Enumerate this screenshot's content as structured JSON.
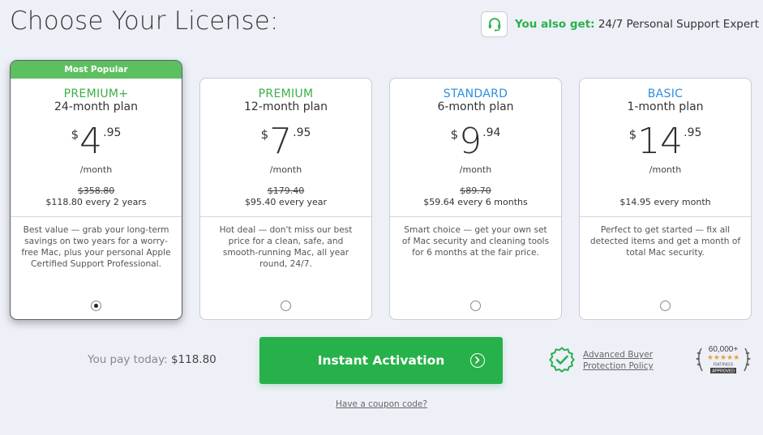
{
  "page": {
    "title": "Choose Your License:",
    "support_prefix": "You also get:",
    "support_text": "24/7 Personal Support Expert"
  },
  "plans": [
    {
      "ribbon": "Most Popular",
      "tier": "PREMIUM+",
      "term": "24-month plan",
      "currency": "$",
      "price_int": "4",
      "price_dec": ".95",
      "per_month": "/month",
      "old_price": "$358.80",
      "billed": "$118.80 every 2 years",
      "description": "Best value — grab your long-term savings on two years for a worry-free Mac, plus your personal Apple Certified Support Professional.",
      "selected": true
    },
    {
      "tier": "PREMIUM",
      "term": "12-month plan",
      "currency": "$",
      "price_int": "7",
      "price_dec": ".95",
      "per_month": "/month",
      "old_price": "$179.40",
      "billed": "$95.40 every year",
      "description": "Hot deal — don't miss our best price for a clean, safe, and smooth-running Mac, all year round, 24/7.",
      "selected": false
    },
    {
      "tier": "STANDARD",
      "term": "6-month plan",
      "currency": "$",
      "price_int": "9",
      "price_dec": ".94",
      "per_month": "/month",
      "old_price": "$89.70",
      "billed": "$59.64 every 6 months",
      "description": "Smart choice — get your own set of Mac security and cleaning tools for 6 months at the fair price.",
      "selected": false
    },
    {
      "tier": "BASIC",
      "term": "1-month plan",
      "currency": "$",
      "price_int": "14",
      "price_dec": ".95",
      "per_month": "/month",
      "old_price": "",
      "billed": "$14.95 every month",
      "description": "Perfect to get started — fix all detected items and get a month of total Mac security.",
      "selected": false
    }
  ],
  "checkout": {
    "pay_label": "You pay today:",
    "pay_amount": "$118.80",
    "cta_label": "Instant Activation",
    "coupon_link": "Have a coupon code?",
    "protection_line1": "Advanced Buyer",
    "protection_line2": "Protection Policy",
    "ratings_count": "60,000+",
    "ratings_label": "RATINGS",
    "ratings_badge": "APPROVED"
  },
  "colors": {
    "accent_green": "#27b14a",
    "tier_green": "#3ab047",
    "tier_blue": "#2d8ee0",
    "ribbon_green": "#5cbf60"
  },
  "icons": {
    "support": "headset-icon",
    "cta": "arrow-circle-right-icon",
    "protection": "shield-check-icon",
    "ratings": "laurel-stars-badge-icon"
  }
}
